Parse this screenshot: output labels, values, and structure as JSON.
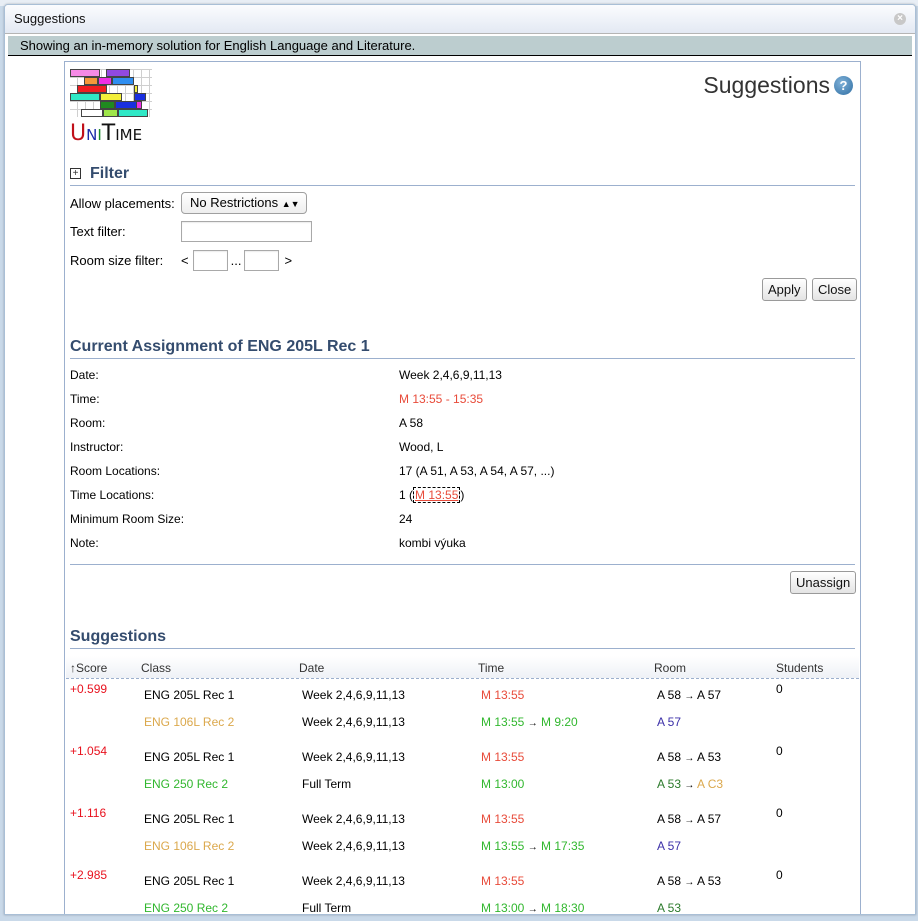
{
  "dialog": {
    "title": "Suggestions",
    "close_icon": "close-circle-icon"
  },
  "info_bar": "Showing an in-memory solution for English Language and Literature.",
  "header": {
    "logo": {
      "u": "U",
      "n": "N",
      "i": "I",
      "t": "T",
      "ime": "IME"
    },
    "title": "Suggestions",
    "help_icon": "?"
  },
  "filter": {
    "heading": "Filter",
    "expand_icon": "+",
    "allow_placements_label": "Allow placements:",
    "allow_placements_value": "No Restrictions",
    "allow_placements_arrow": "⬍",
    "text_filter_label": "Text filter:",
    "text_filter_value": "",
    "room_size_label": "Room size filter:",
    "room_size_lt": "<",
    "room_size_sep": "...",
    "room_size_gt": ">",
    "room_size_min": "",
    "room_size_max": "",
    "apply_label": "Apply",
    "close_label": "Close"
  },
  "current_assignment": {
    "heading": "Current Assignment of ENG 205L Rec 1",
    "rows": [
      {
        "label": "Date:",
        "value": "Week 2,4,6,9,11,13"
      },
      {
        "label": "Time:",
        "value": "M 13:55 - 15:35"
      },
      {
        "label": "Room:",
        "value": "A 58"
      },
      {
        "label": "Instructor:",
        "value": "Wood, L"
      },
      {
        "label": "Room Locations:",
        "value": "17 (A 51, A 53, A 54, A 57, ...)"
      },
      {
        "label": "Time Locations:",
        "value_prefix": "1 (",
        "value_link": "M 13:55",
        "value_suffix": ")"
      },
      {
        "label": "Minimum Room Size:",
        "value": "24"
      },
      {
        "label": "Note:",
        "value": "kombi výuka"
      }
    ],
    "unassign_label": "Unassign"
  },
  "suggestions": {
    "heading": "Suggestions",
    "columns": {
      "score": "↑Score",
      "class": "Class",
      "date": "Date",
      "time": "Time",
      "room": "Room",
      "students": "Students"
    },
    "arrow": "→",
    "items": [
      {
        "score": "+0.599",
        "students": "0",
        "row1": {
          "class": "ENG 205L Rec 1",
          "date": "Week 2,4,6,9,11,13",
          "time": "M 13:55",
          "room_from": "A 58",
          "room_to": "A 57"
        },
        "row2": {
          "class": "ENG 106L Rec 2",
          "date": "Week 2,4,6,9,11,13",
          "time_from": "M 13:55",
          "time_to": "M 9:20",
          "room": "A 57"
        }
      },
      {
        "score": "+1.054",
        "students": "0",
        "row1": {
          "class": "ENG 205L Rec 1",
          "date": "Week 2,4,6,9,11,13",
          "time": "M 13:55",
          "room_from": "A 58",
          "room_to": "A 53"
        },
        "row2": {
          "class": "ENG 250 Rec 2",
          "date": "Full Term",
          "time": "M 13:00",
          "room_from": "A 53",
          "room_to": "A C3"
        }
      },
      {
        "score": "+1.116",
        "students": "0",
        "row1": {
          "class": "ENG 205L Rec 1",
          "date": "Week 2,4,6,9,11,13",
          "time": "M 13:55",
          "room_from": "A 58",
          "room_to": "A 57"
        },
        "row2": {
          "class": "ENG 106L Rec 2",
          "date": "Week 2,4,6,9,11,13",
          "time_from": "M 13:55",
          "time_to": "M 17:35",
          "room": "A 57"
        }
      },
      {
        "score": "+2.985",
        "students": "0",
        "row1": {
          "class": "ENG 205L Rec 1",
          "date": "Week 2,4,6,9,11,13",
          "time": "M 13:55",
          "room_from": "A 58",
          "room_to": "A 53"
        },
        "row2": {
          "class": "ENG 250 Rec 2",
          "date": "Full Term",
          "time_from": "M 13:00",
          "time_to": "M 18:30",
          "room": "A 53"
        }
      }
    ]
  },
  "colors": {
    "header_text": "#344c6e",
    "info_bar_bg": "#bccdcf",
    "conflict_red": "#e84b3a",
    "score_red": "#e8121e",
    "preferred_green": "#31b72e",
    "discouraged_gold": "#dba84c",
    "room_purple": "#3b2fa8"
  }
}
